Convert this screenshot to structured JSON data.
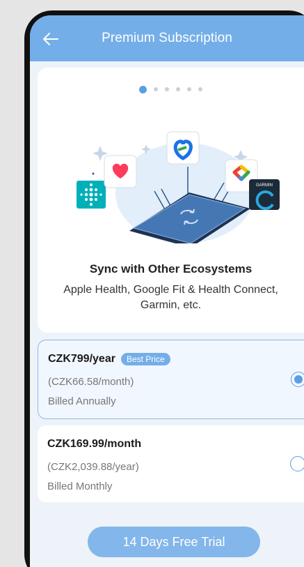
{
  "header": {
    "title": "Premium Subscription"
  },
  "carousel": {
    "dot_count": 6,
    "active_index": 0
  },
  "feature": {
    "title": "Sync with Other Ecosystems",
    "description": "Apple Health, Google Fit & Health Connect, Garmin, etc.",
    "icons": [
      "fitbit-icon",
      "apple-health-heart-icon",
      "health-connect-icon",
      "google-fit-icon",
      "garmin-connect-icon",
      "phone-sync-icon"
    ],
    "garmin_label": "GARMIN"
  },
  "plans": [
    {
      "price": "CZK799/year",
      "badge": "Best Price",
      "sub_price": "(CZK66.58/month)",
      "billing": "Billed Annually",
      "selected": true
    },
    {
      "price": "CZK169.99/month",
      "badge": "",
      "sub_price": "(CZK2,039.88/year)",
      "billing": "Billed Monthly",
      "selected": false
    }
  ],
  "cta": {
    "label": "14 Days Free Trial"
  },
  "colors": {
    "accent": "#74aee8",
    "radio": "#5a9ee6",
    "background": "#eef3f9"
  }
}
